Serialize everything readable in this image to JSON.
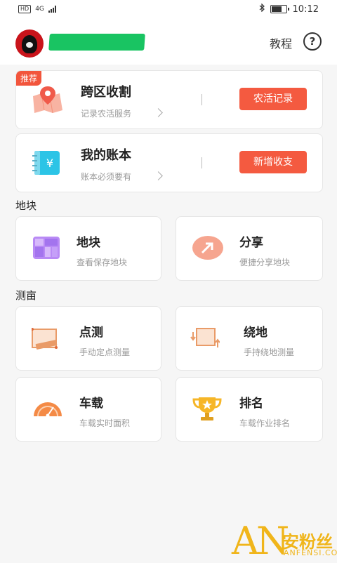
{
  "status_bar": {
    "left_hd": "HD",
    "left_net": "4G",
    "time": "10:12",
    "battery_level": 0.75
  },
  "header": {
    "tutorial_label": "教程",
    "help_symbol": "?"
  },
  "cards": [
    {
      "badge": "推荐",
      "title": "跨区收割",
      "subtitle": "记录农活服务",
      "action": "农活记录",
      "icon": "map-pin-icon"
    },
    {
      "title": "我的账本",
      "subtitle": "账本必须要有",
      "action": "新增收支",
      "icon": "ledger-yuan-icon"
    }
  ],
  "sections": [
    {
      "title": "地块",
      "tiles": [
        {
          "title": "地块",
          "subtitle": "查看保存地块",
          "icon": "plot-grid-icon"
        },
        {
          "title": "分享",
          "subtitle": "便捷分享地块",
          "icon": "share-arrow-icon"
        }
      ]
    },
    {
      "title": "测亩",
      "tiles": [
        {
          "title": "点测",
          "subtitle": "手动定点测量",
          "icon": "ruler-icon"
        },
        {
          "title": "绕地",
          "subtitle": "手持绕地测量",
          "icon": "walk-around-icon"
        },
        {
          "title": "车载",
          "subtitle": "车载实时面积",
          "icon": "speedometer-icon"
        },
        {
          "title": "排名",
          "subtitle": "车载作业排名",
          "icon": "trophy-icon"
        }
      ]
    }
  ],
  "watermark": {
    "big": "AN",
    "cn": "安粉丝",
    "en": "ANFENSI.COM"
  },
  "colors": {
    "accent": "#f45a40",
    "badge": "#f2553c",
    "mask_green": "#19c462",
    "watermark": "#f0b51a"
  }
}
